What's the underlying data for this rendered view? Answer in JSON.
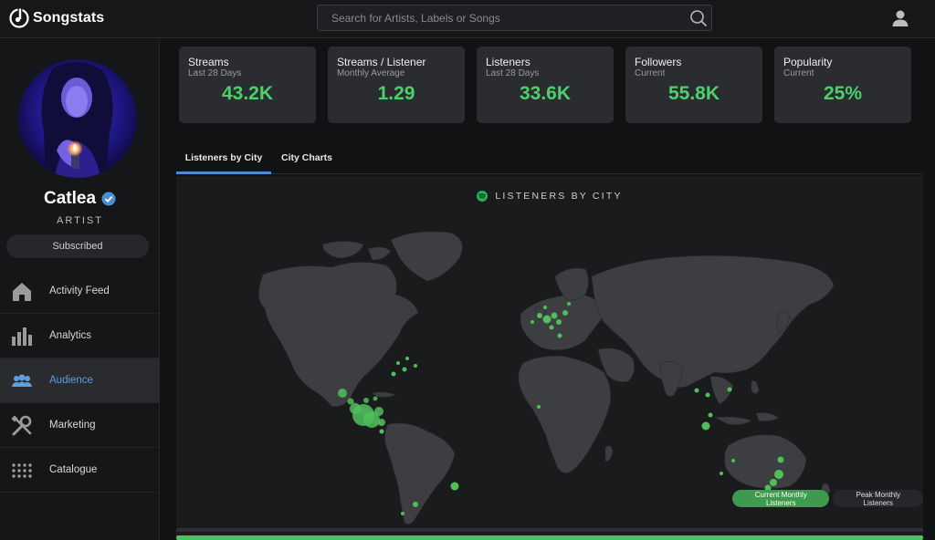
{
  "app": {
    "name": "Songstats"
  },
  "search": {
    "placeholder": "Search for Artists, Labels or Songs"
  },
  "artist": {
    "name": "Catlea",
    "role": "ARTIST",
    "subscribed_label": "Subscribed"
  },
  "nav": {
    "items": [
      {
        "label": "Activity Feed",
        "icon": "home-icon"
      },
      {
        "label": "Analytics",
        "icon": "bar-chart-icon"
      },
      {
        "label": "Audience",
        "icon": "people-icon",
        "active": true
      },
      {
        "label": "Marketing",
        "icon": "tools-icon"
      },
      {
        "label": "Catalogue",
        "icon": "grid-icon"
      }
    ]
  },
  "stats": [
    {
      "title": "Streams",
      "sub": "Last 28 Days",
      "value": "43.2K"
    },
    {
      "title": "Streams / Listener",
      "sub": "Monthly Average",
      "value": "1.29"
    },
    {
      "title": "Listeners",
      "sub": "Last 28 Days",
      "value": "33.6K"
    },
    {
      "title": "Followers",
      "sub": "Current",
      "value": "55.8K"
    },
    {
      "title": "Popularity",
      "sub": "Current",
      "value": "25%"
    }
  ],
  "tabs": [
    {
      "label": "Listeners by City",
      "active": true
    },
    {
      "label": "City Charts",
      "active": false
    }
  ],
  "map": {
    "title": "LISTENERS BY CITY",
    "legend": {
      "current": "Current Monthly Listeners",
      "peak": "Peak Monthly Listeners"
    }
  },
  "colors": {
    "accent_green": "#4bd16a",
    "accent_blue": "#5d9fe0",
    "background": "#111214"
  }
}
